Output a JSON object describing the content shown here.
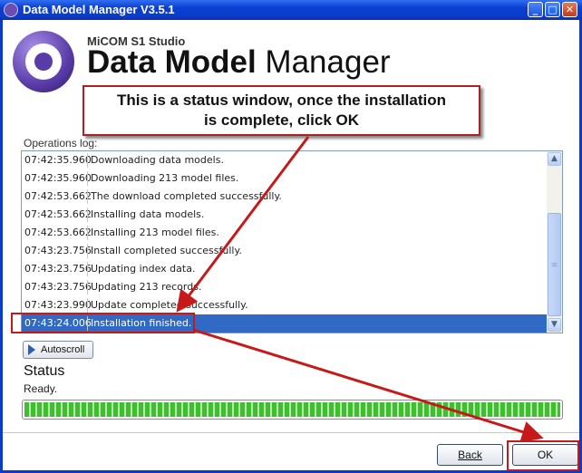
{
  "window": {
    "title": "Data Model Manager V3.5.1"
  },
  "header": {
    "product_line": "MiCOM S1 Studio",
    "title_bold": "Data Model",
    "title_light": " Manager"
  },
  "callout": {
    "line1": "This is a status window, once the installation",
    "line2": "is complete, click OK"
  },
  "log": {
    "label": "Operations log:",
    "rows": [
      {
        "time": "07:42:35.960",
        "message": "Downloading data models."
      },
      {
        "time": "07:42:35.960",
        "message": "Downloading  213 model files."
      },
      {
        "time": "07:42:53.662",
        "message": "The download completed successfully."
      },
      {
        "time": "07:42:53.662",
        "message": "Installing data models."
      },
      {
        "time": "07:42:53.662",
        "message": "Installing  213 model files."
      },
      {
        "time": "07:43:23.756",
        "message": "Install completed successfully."
      },
      {
        "time": "07:43:23.756",
        "message": "Updating index data."
      },
      {
        "time": "07:43:23.756",
        "message": "Updating  213 records."
      },
      {
        "time": "07:43:23.990",
        "message": "Update completed successfully."
      },
      {
        "time": "07:43:24.006",
        "message": "Installation finished."
      }
    ],
    "selected_index": 9
  },
  "autoscroll": {
    "label": "Autoscroll"
  },
  "status": {
    "heading": "Status",
    "text": "Ready.",
    "progress_percent": 100
  },
  "buttons": {
    "back": "Back",
    "ok": "OK"
  },
  "colors": {
    "annotation_red": "#c61a1a",
    "selection_blue": "#316ac5",
    "progress_green": "#3fbf2f"
  }
}
